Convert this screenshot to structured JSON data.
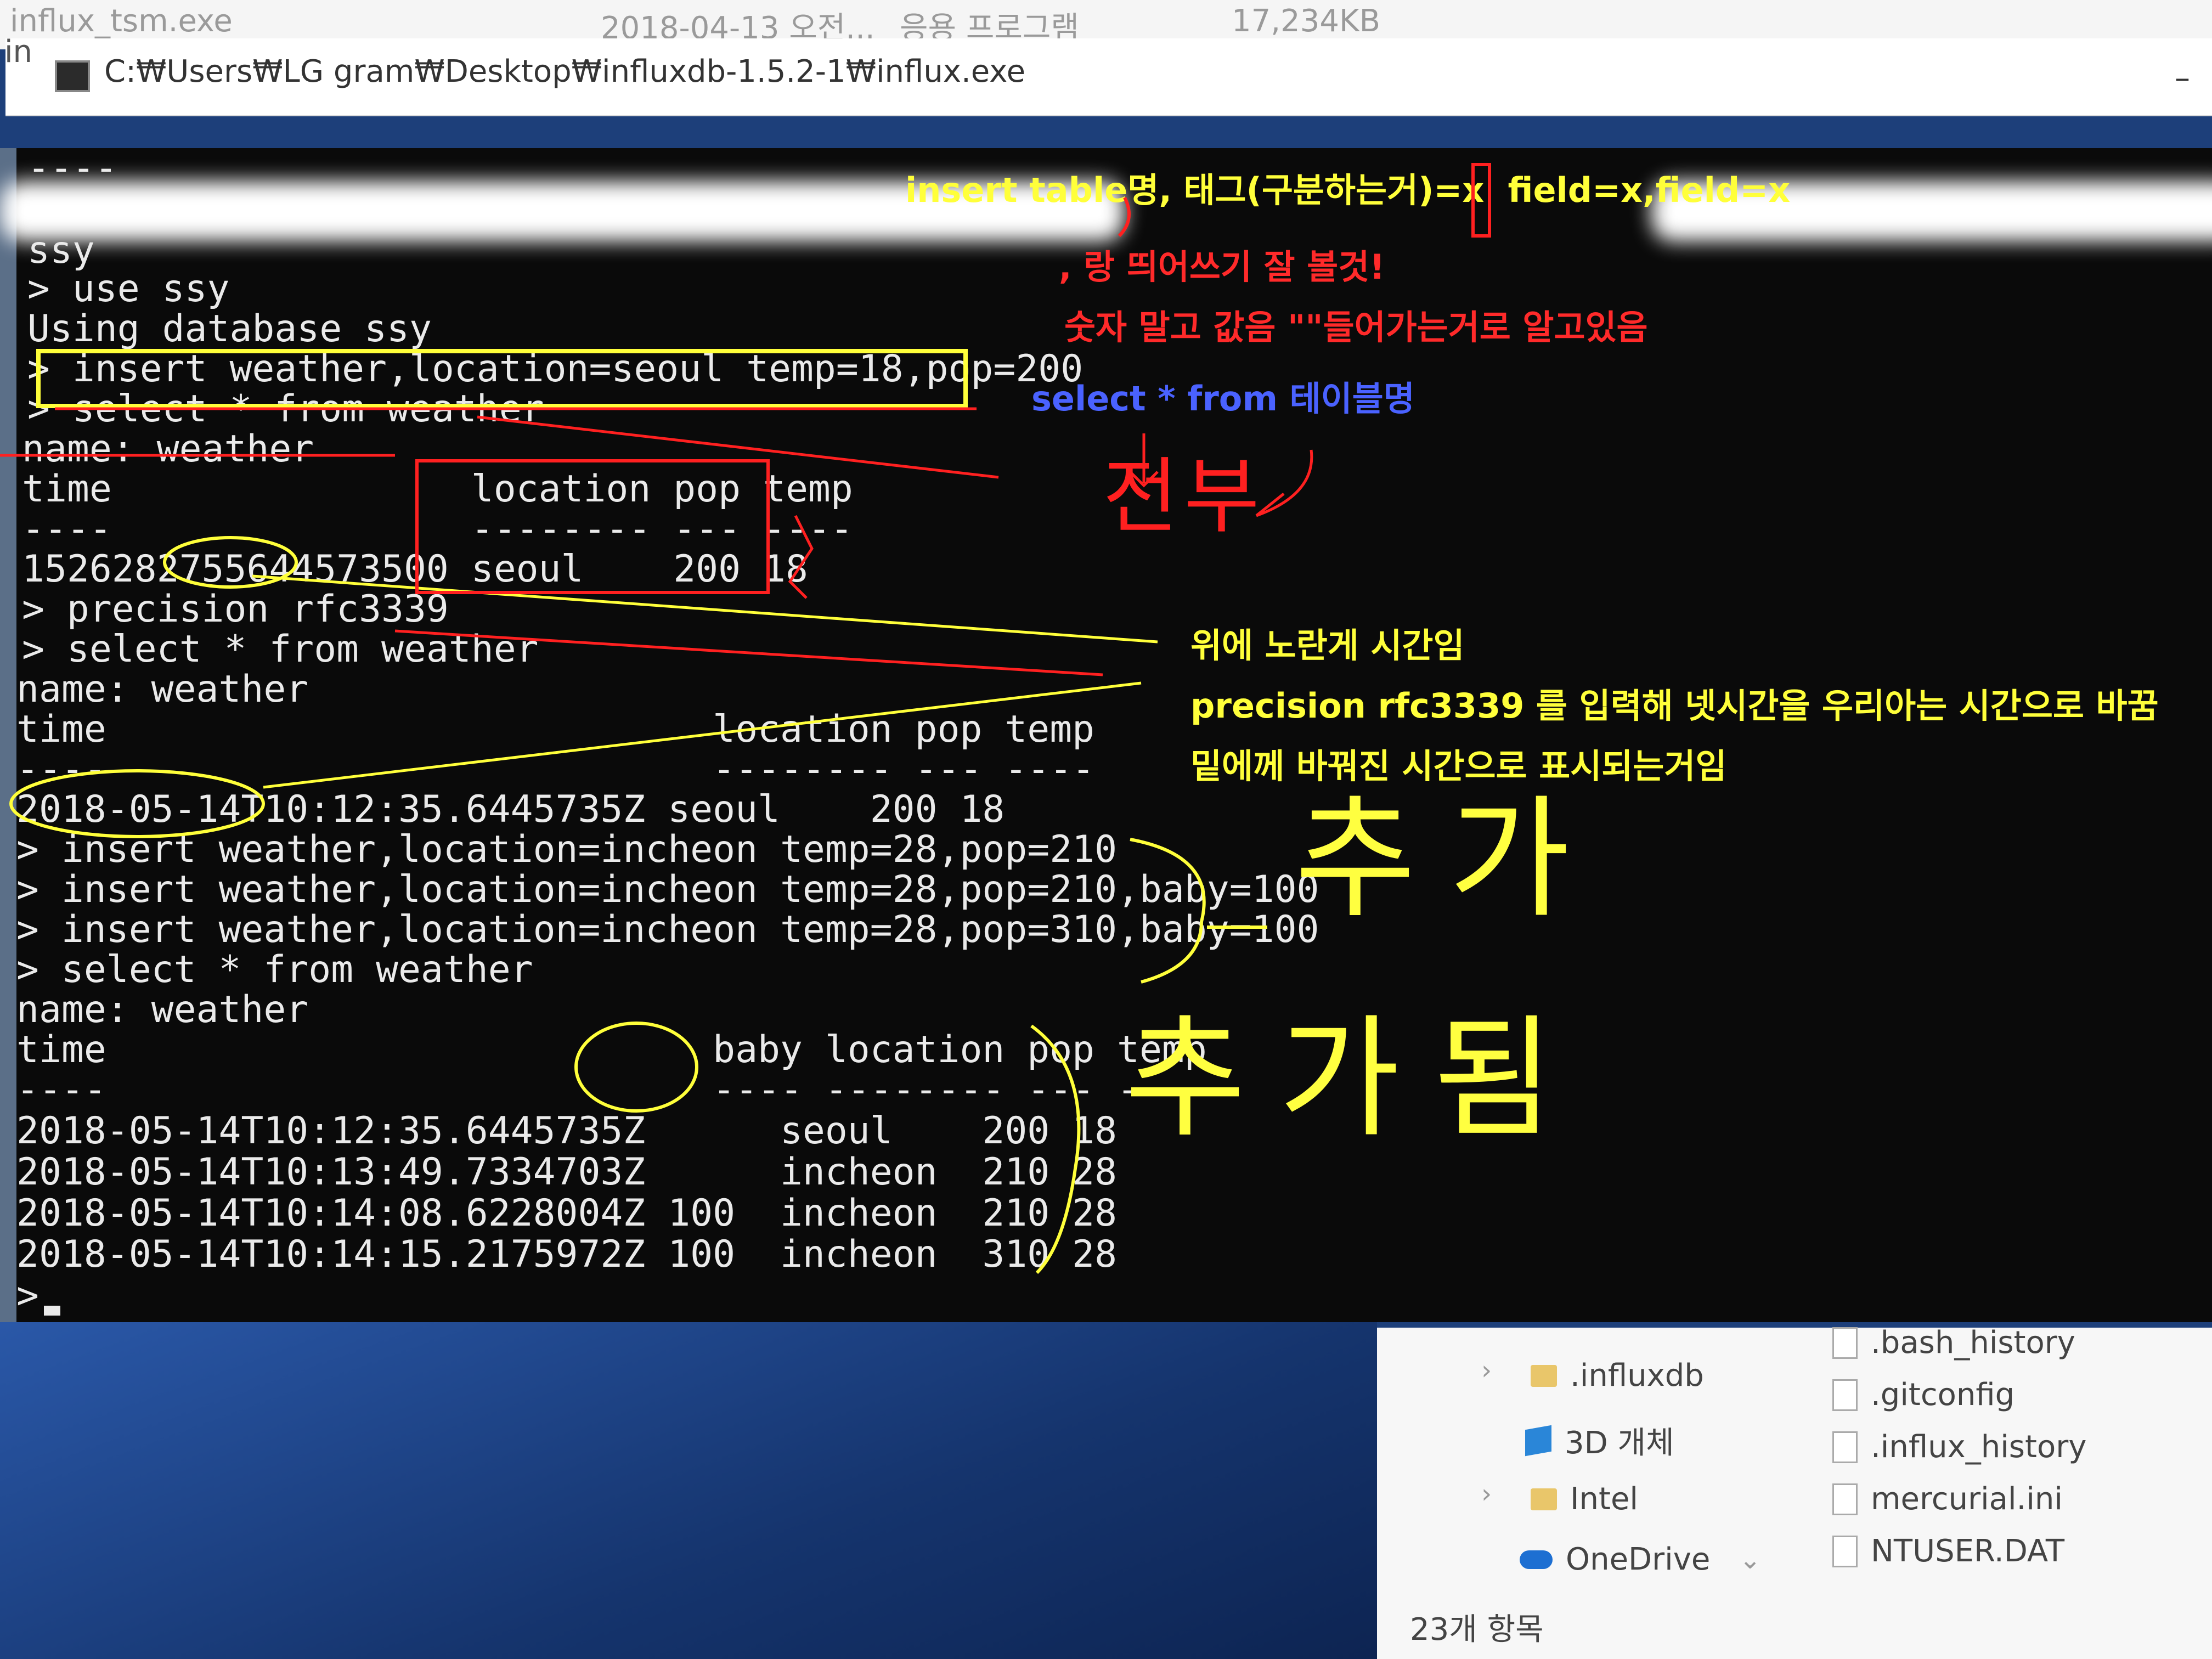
{
  "explorer_top": {
    "filename": "influx_tsm.exe",
    "date": "2018-04-13 오전...",
    "type": "응용 프로그램",
    "size": "17,234KB"
  },
  "window": {
    "title": "C:₩Users₩LG gram₩Desktop₩influxdb-1.5.2-1₩influx.exe",
    "left_fragment": "in",
    "minimize": "–"
  },
  "console": {
    "lines": [
      "----",
      "ssy",
      "> use ssy",
      "Using database ssy",
      "> insert weather,location=seoul temp=18,pop=200",
      "> select * from weather",
      "name: weather",
      "time                location pop temp",
      "----                -------- --- ----",
      "1526282755644573500 seoul    200 18",
      "> precision rfc3339",
      "> select * from weather",
      "name: weather",
      "time                           location pop temp",
      "----                           -------- --- ----",
      "2018-05-14T10:12:35.6445735Z seoul    200 18",
      "> insert weather,location=incheon temp=28,pop=210",
      "> insert weather,location=incheon temp=28,pop=210,baby=100",
      "> insert weather,location=incheon temp=28,pop=310,baby=100",
      "> select * from weather",
      "name: weather",
      "time                           baby location pop temp",
      "----                           ---- -------- --- ----",
      "2018-05-14T10:12:35.6445735Z      seoul    200 18",
      "2018-05-14T10:13:49.7334703Z      incheon  210 28",
      "2018-05-14T10:14:08.6228004Z 100  incheon  210 28",
      "2018-05-14T10:14:15.2175972Z 100  incheon  310 28",
      ">"
    ]
  },
  "annotations": {
    "syntax": "insert table명, 태그(구분하는거)=x  field=x,field=x",
    "space_note": ", 랑 띄어쓰기 잘 볼것!",
    "quote_note": "숫자 말고 값음 \"\"들어가는거로 알고있음",
    "select_note": "select * from 테이블명",
    "all_note": "전부",
    "time_note_1": "위에 노란게 시간임",
    "time_note_2": "precision rfc3339 를 입력해 넷시간을 우리아는 시간으로 바꿈",
    "time_note_3": "밑에께 바꿔진 시간으로 표시되는거임",
    "add_note": "추가",
    "added_note": "추가됨"
  },
  "explorer_panel": {
    "items_left": [
      ".influxdb",
      "3D 개체",
      "Intel",
      "OneDrive"
    ],
    "items_right": [
      ".bash_history",
      ".gitconfig",
      ".influx_history",
      "mercurial.ini",
      "NTUSER.DAT"
    ],
    "status": "23개 항목"
  },
  "colors": {
    "console_bg": "#0a0a0a",
    "console_text": "#eaeaea",
    "annot_yellow": "#ffff3a",
    "annot_red": "#ff2a2a",
    "annot_blue": "#4a62ff"
  }
}
